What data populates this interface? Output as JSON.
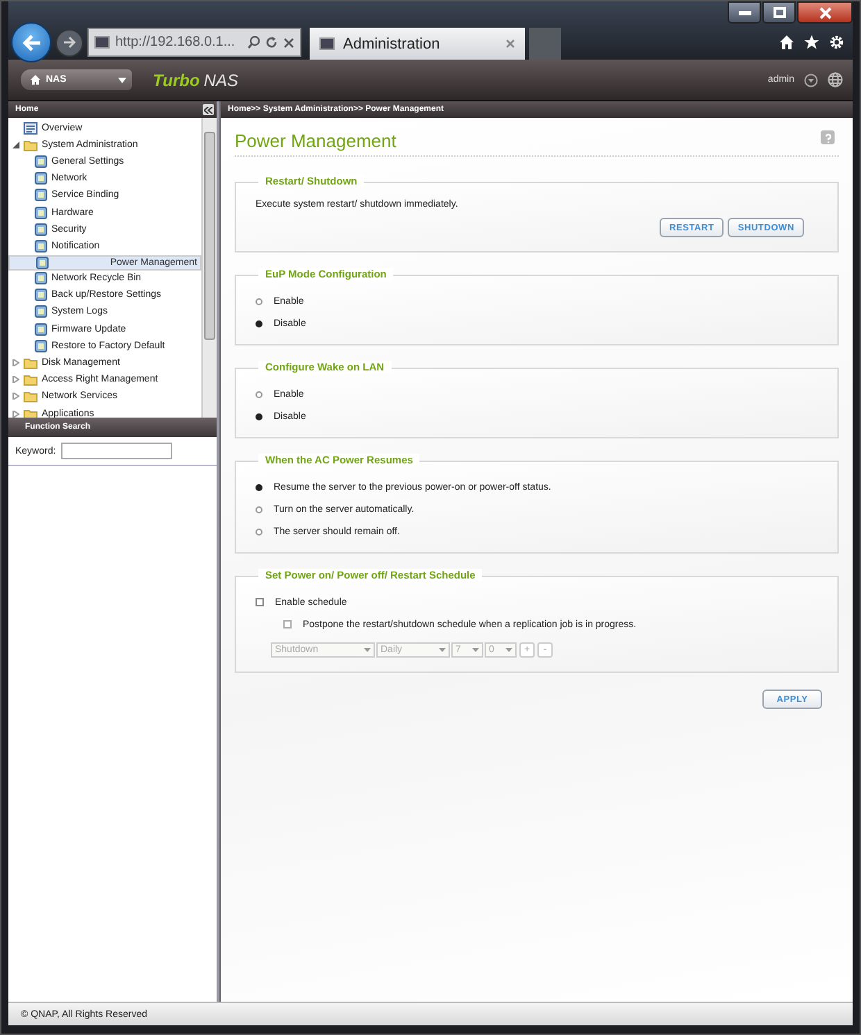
{
  "browser": {
    "url": "http://192.168.0.1...",
    "tab_title": "Administration"
  },
  "app_header": {
    "nas_menu": "NAS",
    "brand_primary": "Turbo",
    "brand_secondary": "NAS",
    "user": "admin"
  },
  "sidebar": {
    "header": "Home",
    "items": [
      {
        "label": "Overview",
        "kind": "page",
        "selected": false
      },
      {
        "label": "System Administration",
        "kind": "folder",
        "expanded": true,
        "selected": false,
        "children": [
          {
            "label": "General Settings",
            "selected": false
          },
          {
            "label": "Network",
            "selected": false
          },
          {
            "label": "Service Binding",
            "selected": false
          },
          {
            "label": "Hardware",
            "selected": false
          },
          {
            "label": "Security",
            "selected": false
          },
          {
            "label": "Notification",
            "selected": false
          },
          {
            "label": "Power Management",
            "selected": true
          },
          {
            "label": "Network Recycle Bin",
            "selected": false
          },
          {
            "label": "Back up/Restore Settings",
            "selected": false
          },
          {
            "label": "System Logs",
            "selected": false
          },
          {
            "label": "Firmware Update",
            "selected": false
          },
          {
            "label": "Restore to Factory Default",
            "selected": false
          }
        ]
      },
      {
        "label": "Disk Management",
        "kind": "folder",
        "expanded": false,
        "selected": false
      },
      {
        "label": "Access Right Management",
        "kind": "folder",
        "expanded": false,
        "selected": false
      },
      {
        "label": "Network Services",
        "kind": "folder",
        "expanded": false,
        "selected": false
      },
      {
        "label": "Applications",
        "kind": "folder",
        "expanded": false,
        "selected": false
      }
    ]
  },
  "function_search": {
    "title": "Function Search",
    "keyword_label": "Keyword:"
  },
  "breadcrumb": "Home>> System Administration>> Power Management",
  "page_title": "Power Management",
  "sections": [
    {
      "kind": "buttons",
      "title": "Restart/ Shutdown",
      "description": "Execute system restart/ shutdown immediately.",
      "buttons": [
        "RESTART",
        "SHUTDOWN"
      ]
    },
    {
      "kind": "radios",
      "title": "EuP Mode Configuration",
      "options": [
        {
          "label": "Enable",
          "selected": false
        },
        {
          "label": "Disable",
          "selected": true
        }
      ]
    },
    {
      "kind": "radios",
      "title": "Configure Wake on LAN",
      "options": [
        {
          "label": "Enable",
          "selected": false
        },
        {
          "label": "Disable",
          "selected": true
        }
      ]
    },
    {
      "kind": "radios",
      "title": "When the AC Power Resumes",
      "options": [
        {
          "label": "Resume the server to the previous power-on or power-off status.",
          "selected": true
        },
        {
          "label": "Turn on the server automatically.",
          "selected": false
        },
        {
          "label": "The server should remain off.",
          "selected": false
        }
      ]
    },
    {
      "kind": "schedule",
      "title": "Set Power on/ Power off/ Restart Schedule",
      "enable": {
        "label": "Enable schedule",
        "checked": false
      },
      "postpone": {
        "label": "Postpone the restart/shutdown schedule when a replication job is in progress.",
        "checked": false,
        "disabled": true
      },
      "selects": [
        {
          "value": "Shutdown",
          "disabled": true
        },
        {
          "value": "Daily",
          "disabled": true
        },
        {
          "value": "7",
          "disabled": true
        },
        {
          "value": "0",
          "disabled": true
        }
      ],
      "add_button": "+",
      "remove_button": "-"
    }
  ],
  "apply_button": "APPLY",
  "footer": "© QNAP, All Rights Reserved"
}
